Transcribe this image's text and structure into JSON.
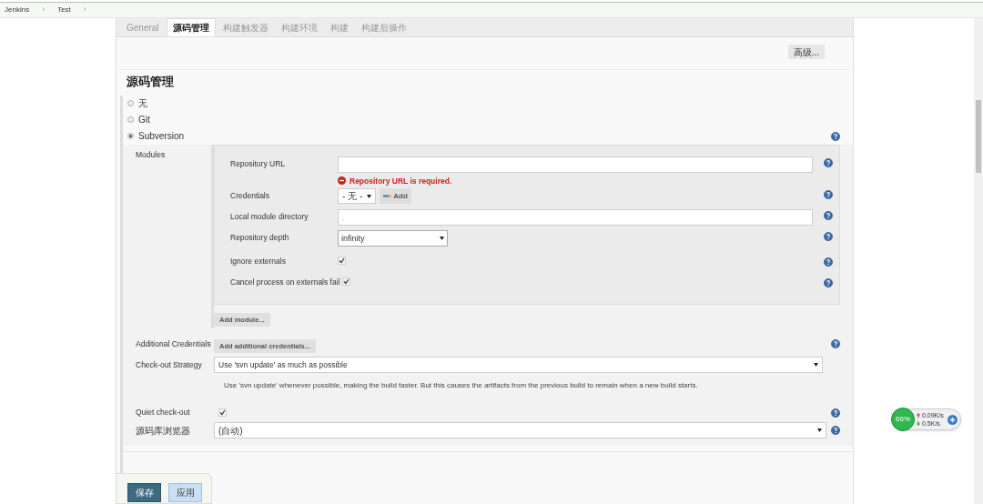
{
  "breadcrumbs": [
    {
      "label": "Jenkins",
      "separator": "›"
    },
    {
      "label": "Test",
      "separator": "›"
    }
  ],
  "tabs": [
    {
      "label": "General",
      "selected": false
    },
    {
      "label": "源码管理",
      "selected": true
    },
    {
      "label": "构建触发器",
      "selected": false
    },
    {
      "label": "构建环境",
      "selected": false
    },
    {
      "label": "构建",
      "selected": false
    },
    {
      "label": "构建后操作",
      "selected": false
    }
  ],
  "advanced_button": "高级...",
  "section_title": "源码管理",
  "scm_options": [
    {
      "label": "无",
      "selected": false
    },
    {
      "label": "Git",
      "selected": false
    },
    {
      "label": "Subversion",
      "selected": true
    }
  ],
  "modules": {
    "label": "Modules",
    "fields": [
      {
        "kind": "text",
        "label": "Repository URL",
        "error": "Repository URL is required."
      },
      {
        "kind": "credentials",
        "label": "Credentials",
        "value": "- 无 -",
        "add_button": "Add"
      },
      {
        "kind": "text",
        "label": "Local module directory",
        "placeholder": "."
      },
      {
        "kind": "select",
        "label": "Repository depth",
        "value": "infinity"
      },
      {
        "kind": "checkbox",
        "label": "Ignore externals",
        "checked": true
      },
      {
        "kind": "checkbox",
        "label": "Cancel process on externals fail",
        "checked": true
      }
    ],
    "add_button": "Add module..."
  },
  "additional_credentials": {
    "label": "Additional Credentials",
    "button": "Add additional credentials..."
  },
  "checkout_strategy": {
    "label": "Check-out Strategy",
    "value": "Use 'svn update' as much as possible",
    "description": "Use 'svn update' whenever possible, making the build faster. But this causes the artifacts from the previous build to remain when a new build starts."
  },
  "quiet_checkout": {
    "label": "Quiet check-out",
    "checked": true
  },
  "repository_browser": {
    "label": "源码库浏览器",
    "value": "(自动)"
  },
  "footer_buttons": [
    {
      "label": "保存",
      "kind": "primary"
    },
    {
      "label": "应用",
      "kind": "secondary"
    }
  ],
  "network_widget": {
    "percent": "66%",
    "upload": "0.09K/s",
    "download": "0.5K/s"
  }
}
